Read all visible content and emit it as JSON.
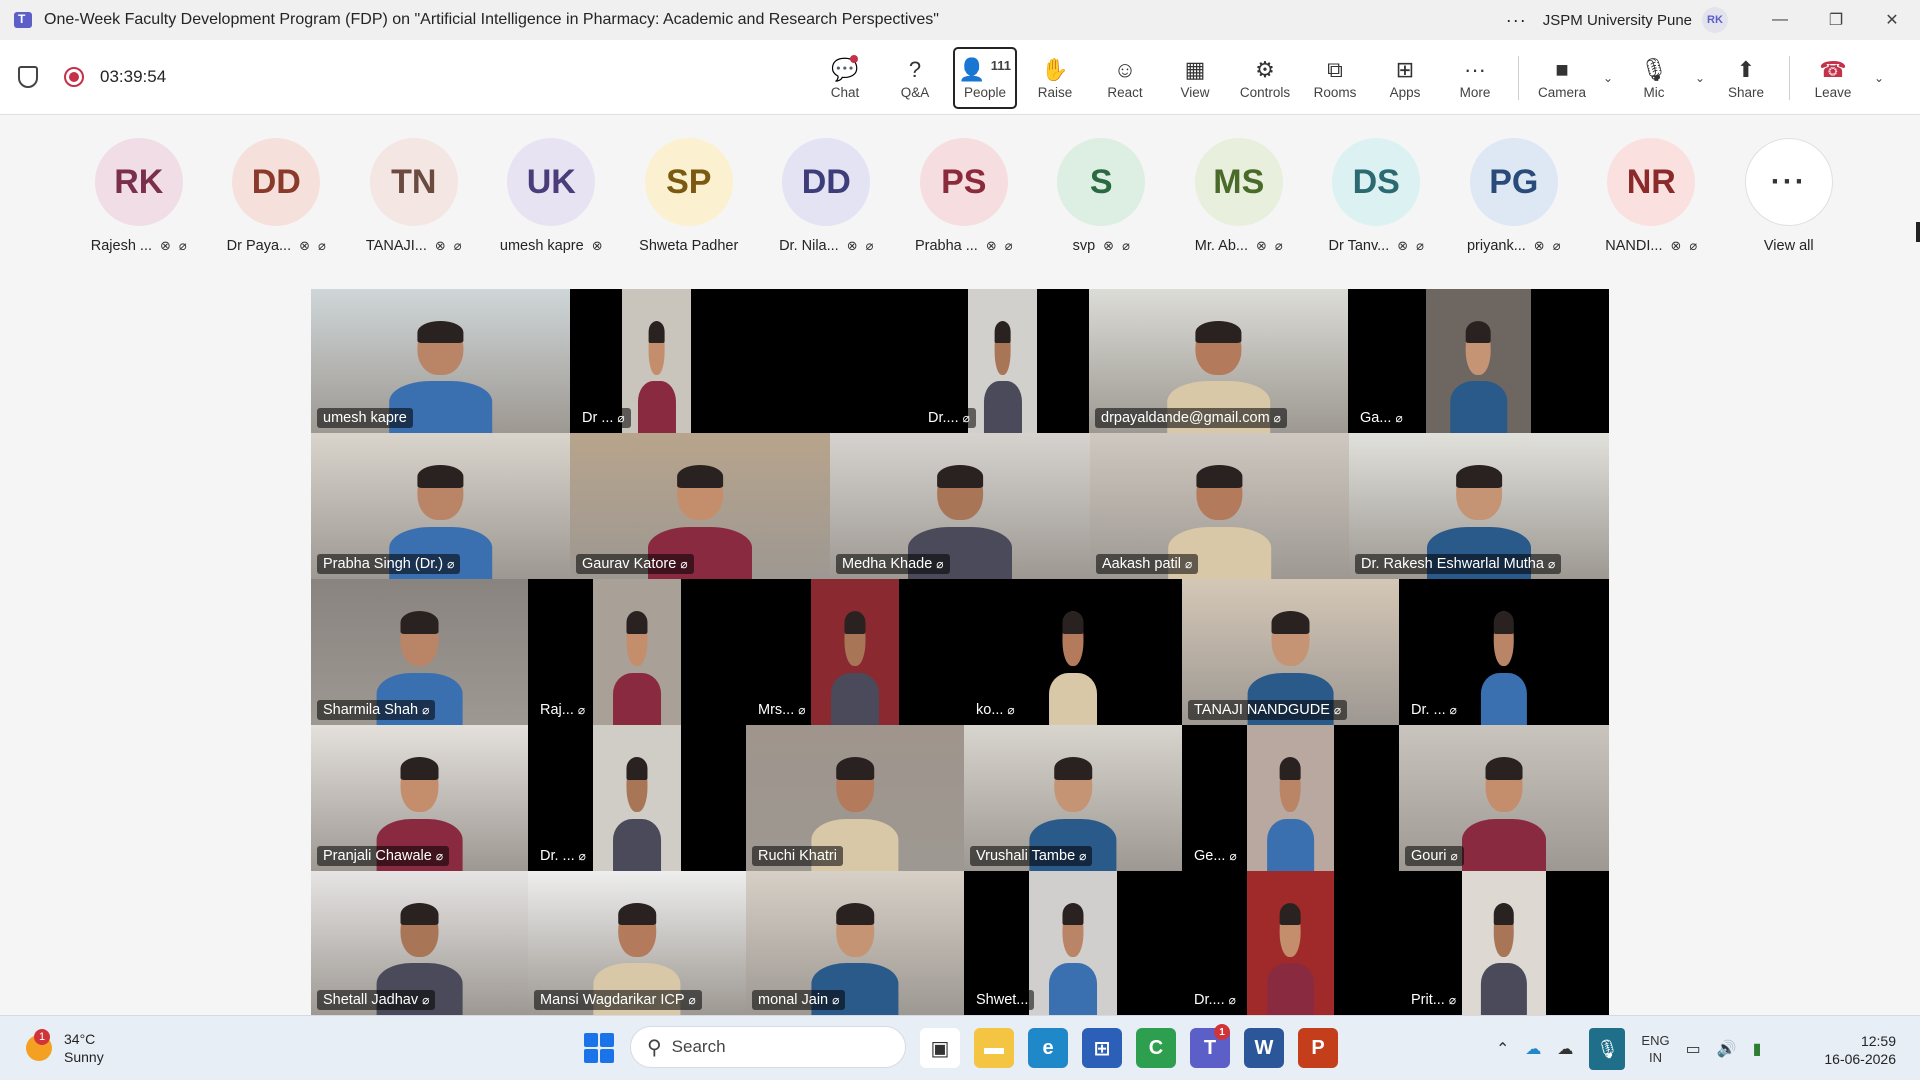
{
  "window": {
    "title": "One-Week Faculty Development Program (FDP) on \"Artificial Intelligence in Pharmacy: Academic and Research Perspectives\"",
    "org": "JSPM University Pune",
    "user_initials": "RK"
  },
  "toolbar": {
    "timer": "03:39:54",
    "chat": "Chat",
    "qa": "Q&A",
    "people": "People",
    "people_count": "111",
    "raise": "Raise",
    "react": "React",
    "view": "View",
    "controls": "Controls",
    "rooms": "Rooms",
    "apps": "Apps",
    "more": "More",
    "camera": "Camera",
    "mic": "Mic",
    "share": "Share",
    "leave": "Leave"
  },
  "participants": [
    {
      "initials": "RK",
      "name": "Rajesh ...",
      "bg": "#f1dde6",
      "fg": "#7a2f4d"
    },
    {
      "initials": "DD",
      "name": "Dr Paya...",
      "bg": "#f6e0dc",
      "fg": "#8a3a2a"
    },
    {
      "initials": "TN",
      "name": "TANAJI...",
      "bg": "#f4e6e2",
      "fg": "#6b4a40"
    },
    {
      "initials": "UK",
      "name": "umesh kapre",
      "bg": "#e8e3f2",
      "fg": "#4b3d7a"
    },
    {
      "initials": "SP",
      "name": "Shweta Padher",
      "bg": "#fbf0cf",
      "fg": "#7a5a10"
    },
    {
      "initials": "DD",
      "name": "Dr. Nila...",
      "bg": "#e3e3f3",
      "fg": "#3d3d7a"
    },
    {
      "initials": "PS",
      "name": "Prabha ...",
      "bg": "#f6dde0",
      "fg": "#8a2a3a"
    },
    {
      "initials": "S",
      "name": "svp",
      "bg": "#dcefe2",
      "fg": "#2a6a40"
    },
    {
      "initials": "MS",
      "name": "Mr. Ab...",
      "bg": "#e8efdc",
      "fg": "#4a6a2a"
    },
    {
      "initials": "DS",
      "name": "Dr Tanv...",
      "bg": "#dcf1f2",
      "fg": "#2a6a70"
    },
    {
      "initials": "PG",
      "name": "priyank...",
      "bg": "#dde8f4",
      "fg": "#2a4a7a"
    },
    {
      "initials": "NR",
      "name": "NANDI...",
      "bg": "#fbe0e0",
      "fg": "#8a2a2a"
    }
  ],
  "view_all": "View all",
  "videos": [
    {
      "name": "umesh kapre",
      "mic": false
    },
    {
      "name": "Dr ...",
      "mic": true
    },
    {
      "name": "Dr....",
      "mic": true
    },
    {
      "name": "drpayaldande@gmail.com",
      "mic": true
    },
    {
      "name": "Ga...",
      "mic": true
    },
    {
      "name": "Prabha Singh (Dr.)",
      "mic": true
    },
    {
      "name": "Gaurav Katore",
      "mic": true
    },
    {
      "name": "Medha Khade",
      "mic": true
    },
    {
      "name": "Aakash patil",
      "mic": true
    },
    {
      "name": "Dr. Rakesh Eshwarlal Mutha",
      "mic": true
    },
    {
      "name": "Sharmila Shah",
      "mic": true
    },
    {
      "name": "Raj...",
      "mic": true
    },
    {
      "name": "Mrs...",
      "mic": true
    },
    {
      "name": "ko...",
      "mic": true
    },
    {
      "name": "TANAJI NANDGUDE",
      "mic": true
    },
    {
      "name": "Dr. ...",
      "mic": true
    },
    {
      "name": "Pranjali Chawale",
      "mic": true
    },
    {
      "name": "Dr. ...",
      "mic": true
    },
    {
      "name": "Ruchi Khatri",
      "mic": false
    },
    {
      "name": "Vrushali Tambe",
      "mic": true
    },
    {
      "name": "Ge...",
      "mic": true
    },
    {
      "name": "Gouri",
      "mic": true
    },
    {
      "name": "Shetall Jadhav",
      "mic": true
    },
    {
      "name": "Mansi Wagdarikar ICP",
      "mic": true
    },
    {
      "name": "monal Jain",
      "mic": true
    },
    {
      "name": "Shwet...",
      "mic": false
    },
    {
      "name": "Dr....",
      "mic": true
    },
    {
      "name": "Prit...",
      "mic": true
    }
  ],
  "taskbar": {
    "weather_badge": "1",
    "temperature": "34°C",
    "condition": "Sunny",
    "search_placeholder": "Search",
    "teams_badge": "1",
    "lang_line1": "ENG",
    "lang_line2": "IN",
    "time": "12:59",
    "date": "16-06-2026"
  }
}
